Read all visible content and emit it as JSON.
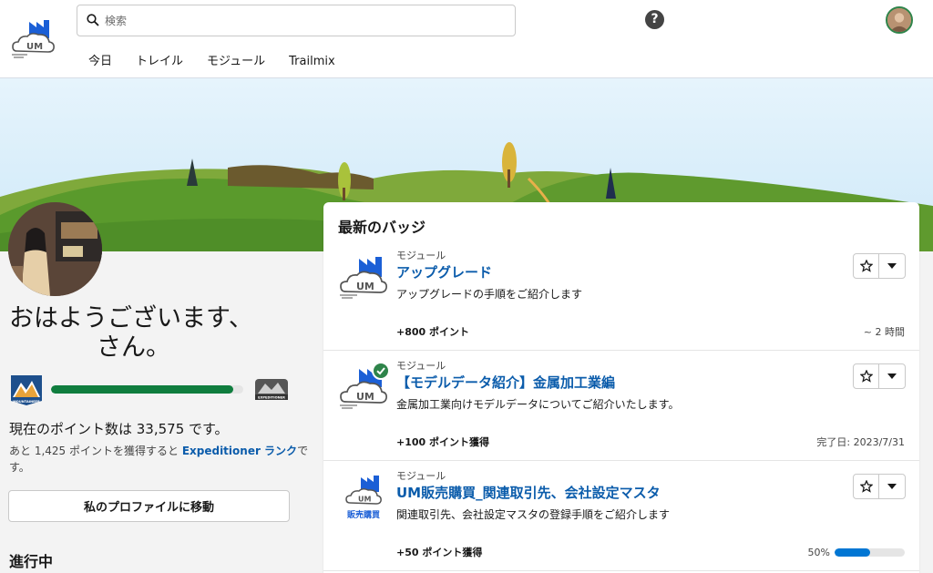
{
  "header": {
    "search_placeholder": "検索",
    "help_label": "?",
    "nav": [
      "今日",
      "トレイル",
      "モジュール",
      "Trailmix"
    ]
  },
  "logo": {
    "text": "UM"
  },
  "profile": {
    "greeting_line1": "おはようございます、",
    "greeting_line2": "さん。",
    "rank_progress": 0.95,
    "rank_left_label": "MOUNTAINEER",
    "rank_right_label": "EXPEDITIONER",
    "points_text": "現在のポイント数は 33,575 です。",
    "next_rank_prefix": "あと 1,425 ポイントを獲得すると ",
    "next_rank_link": "Expeditioner ランク",
    "next_rank_suffix": "です。",
    "profile_button": "私のプロファイルに移動",
    "in_progress_heading": "進行中"
  },
  "badges": {
    "title": "最新のバッジ",
    "items": [
      {
        "type": "モジュール",
        "title": "アップグレード",
        "description": "アップグレードの手順をご紹介します",
        "points": "+800 ポイント",
        "meta": "~ 2 時間",
        "completed": false
      },
      {
        "type": "モジュール",
        "title": "【モデルデータ紹介】金属加工業編",
        "description": "金属加工業向けモデルデータについてご紹介いたします。",
        "points": "+100 ポイント獲得",
        "meta": "完了日: 2023/7/31",
        "completed": true
      },
      {
        "type": "モジュール",
        "title": "UM販売購買_関連取引先、会社設定マスタ",
        "description": "関連取引先、会社設定マスタの登録手順をご紹介します",
        "points": "+50 ポイント獲得",
        "progress_label": "50%",
        "progress": 0.5,
        "icon_caption": "販売購買",
        "completed": false
      }
    ]
  },
  "colors": {
    "link": "#0b5cab",
    "rank_bar": "#0f7d3e",
    "progress_bar": "#0176d3",
    "check": "#2e844a",
    "logo_blue": "#1b5fd6"
  }
}
